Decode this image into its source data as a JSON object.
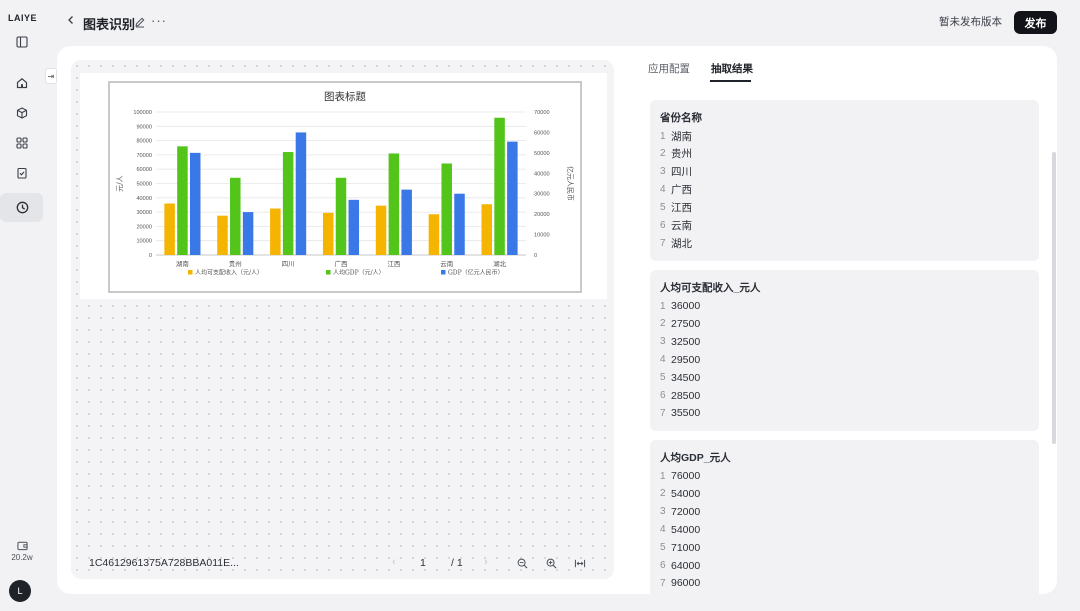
{
  "app": {
    "logo": "LAIYE",
    "quota": "20.2w",
    "avatar_initial": "L",
    "rail_icons": [
      "sidebar-toggle-icon",
      "home-icon",
      "cube-icon",
      "apps-icon",
      "task-icon",
      "history-icon"
    ]
  },
  "header": {
    "title": "图表识别",
    "unpublished_label": "暂未发布版本",
    "publish_label": "发布"
  },
  "preview": {
    "file_id": "1C4612961375A728BBA011E...",
    "page_current": "1",
    "page_total_label": "/ 1"
  },
  "tabs": [
    {
      "label": "应用配置",
      "active": false
    },
    {
      "label": "抽取结果",
      "active": true
    }
  ],
  "results": [
    {
      "title": "省份名称",
      "items": [
        {
          "n": "1",
          "v": "湖南"
        },
        {
          "n": "2",
          "v": "贵州"
        },
        {
          "n": "3",
          "v": "四川"
        },
        {
          "n": "4",
          "v": "广西"
        },
        {
          "n": "5",
          "v": "江西"
        },
        {
          "n": "6",
          "v": "云南"
        },
        {
          "n": "7",
          "v": "湖北"
        }
      ]
    },
    {
      "title": "人均可支配收入_元人",
      "items": [
        {
          "n": "1",
          "v": "36000"
        },
        {
          "n": "2",
          "v": "27500"
        },
        {
          "n": "3",
          "v": "32500"
        },
        {
          "n": "4",
          "v": "29500"
        },
        {
          "n": "5",
          "v": "34500"
        },
        {
          "n": "6",
          "v": "28500"
        },
        {
          "n": "7",
          "v": "35500"
        }
      ]
    },
    {
      "title": "人均GDP_元人",
      "items": [
        {
          "n": "1",
          "v": "76000"
        },
        {
          "n": "2",
          "v": "54000"
        },
        {
          "n": "3",
          "v": "72000"
        },
        {
          "n": "4",
          "v": "54000"
        },
        {
          "n": "5",
          "v": "71000"
        },
        {
          "n": "6",
          "v": "64000"
        },
        {
          "n": "7",
          "v": "96000"
        }
      ]
    }
  ],
  "chart_data": {
    "type": "bar",
    "title": "图表标题",
    "ylabel": "元/人",
    "y2label": "亿元人民币",
    "categories": [
      "湖南",
      "贵州",
      "四川",
      "广西",
      "江西",
      "云南",
      "湖北"
    ],
    "ylim": [
      0,
      100000
    ],
    "y2lim": [
      0,
      70000
    ],
    "yticks": [
      "0",
      "10000",
      "20000",
      "30000",
      "40000",
      "50000",
      "60000",
      "70000",
      "80000",
      "90000",
      "100000"
    ],
    "y2ticks": [
      "0",
      "10000",
      "20000",
      "30000",
      "40000",
      "50000",
      "60000",
      "70000"
    ],
    "legend_position": "bottom",
    "grid": true,
    "series": [
      {
        "name": "人均可支配收入（元/人）",
        "axis": "left",
        "color": "#f5b400",
        "values": [
          36000,
          27500,
          32500,
          29500,
          34500,
          28500,
          35500
        ]
      },
      {
        "name": "人均GDP（元/人）",
        "axis": "left",
        "color": "#52c41a",
        "values": [
          76000,
          54000,
          72000,
          54000,
          71000,
          64000,
          96000
        ]
      },
      {
        "name": "GDP（亿元人民币）",
        "axis": "right",
        "color": "#3b78e7",
        "values": [
          50000,
          21000,
          60000,
          27000,
          32000,
          30000,
          55500
        ]
      }
    ]
  }
}
